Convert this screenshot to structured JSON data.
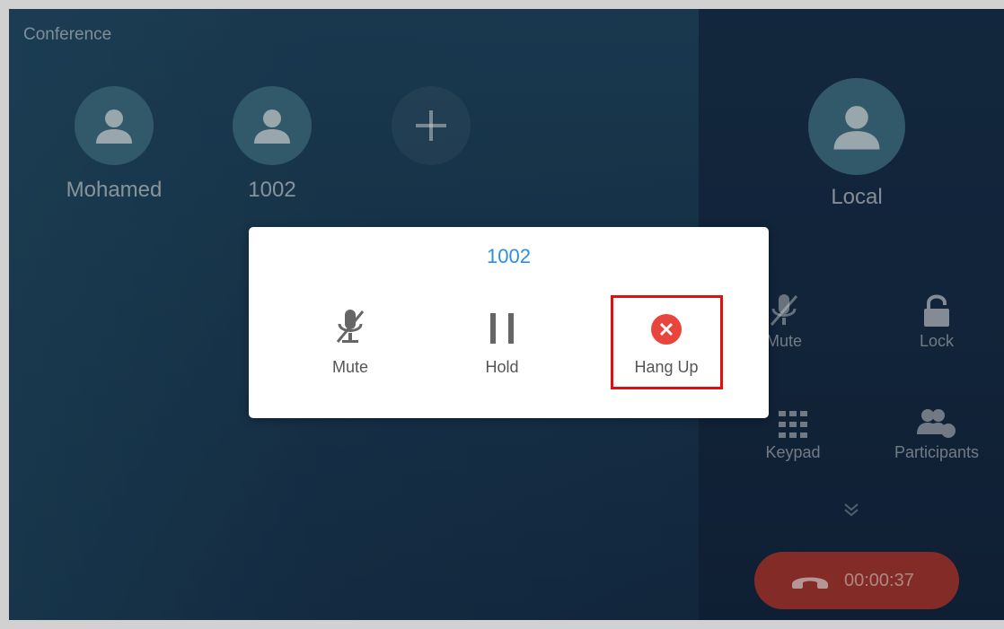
{
  "screen_title": "Conference",
  "participants": [
    {
      "name": "Mohamed",
      "icon": "person-icon"
    },
    {
      "name": "1002",
      "icon": "person-icon"
    }
  ],
  "add_participant_icon": "plus-icon",
  "local": {
    "name": "Local",
    "icon": "person-icon"
  },
  "controls": {
    "mute": "Mute",
    "lock": "Lock",
    "keypad": "Keypad",
    "participants": "Participants"
  },
  "expand_icon": "chevron-double-down-icon",
  "call": {
    "duration": "00:00:37",
    "icon": "hangup-handset-icon",
    "color": "#a03630"
  },
  "dialog": {
    "title": "1002",
    "actions": {
      "mute": "Mute",
      "hold": "Hold",
      "hangup": "Hang Up"
    }
  },
  "colors": {
    "accent_blue": "#2e8de0",
    "hangup_red": "#e8453c",
    "highlight_red": "#e01010"
  }
}
